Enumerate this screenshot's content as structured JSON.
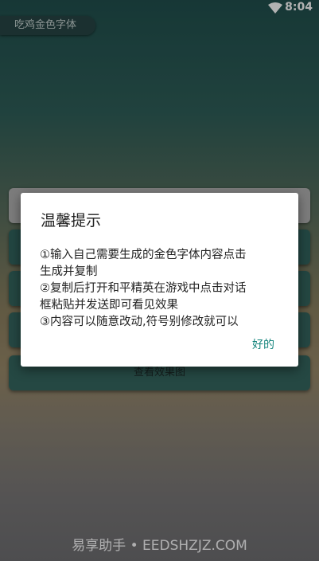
{
  "status_bar": {
    "time": "8:04",
    "wifi_icon": "wifi-icon"
  },
  "app": {
    "title": "吃鸡金色字体"
  },
  "input": {
    "value": ""
  },
  "buttons": {
    "btn1": "",
    "btn2": "",
    "btn3": "",
    "view_effect": "查看效果图"
  },
  "dialog": {
    "title": "温馨提示",
    "lines": [
      "①输入自己需要生成的金色字体内容点击",
      "生成并复制",
      "②复制后打开和平精英在游戏中点击对话",
      "框粘贴并发送即可看见效果",
      "③内容可以随意改动,符号别修改就可以"
    ],
    "ok_label": "好的"
  },
  "watermark": "易享助手 • EEDSHZJZ.COM",
  "colors": {
    "accent": "#14847c"
  }
}
